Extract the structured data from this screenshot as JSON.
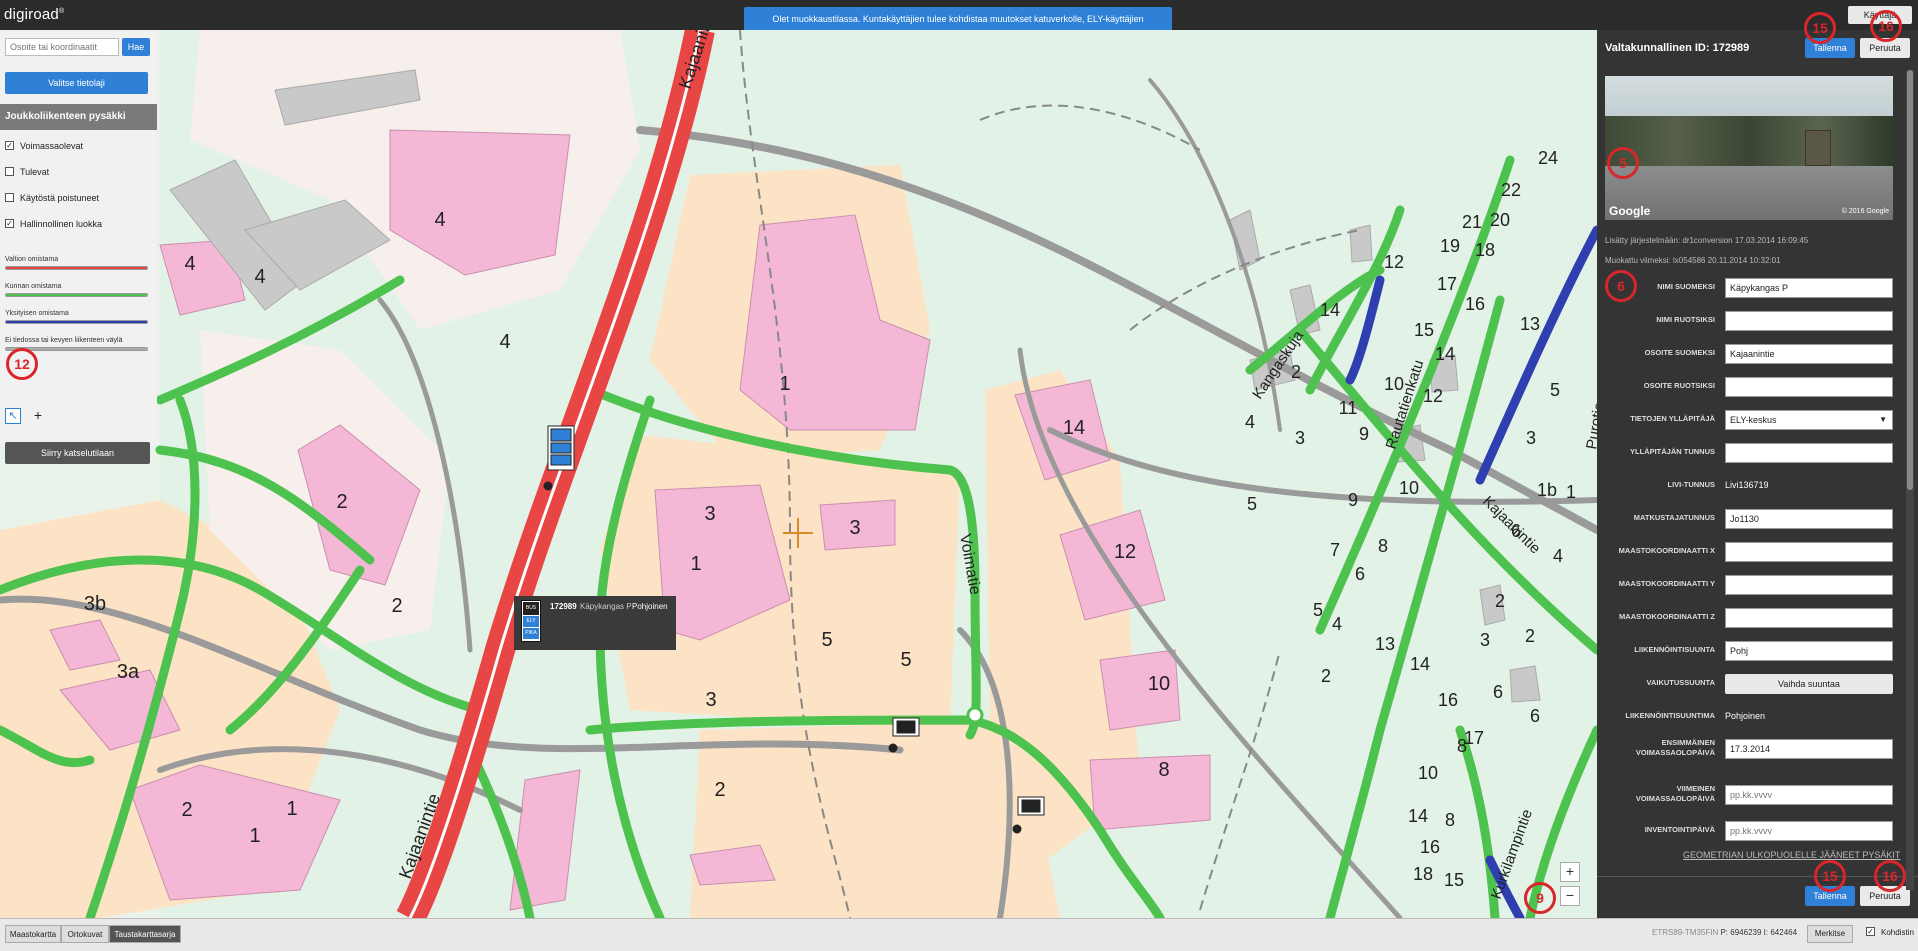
{
  "app": {
    "logo": "digiroad",
    "logo_mark": "®",
    "user_button": "Käyttäjä"
  },
  "notice": "Olet muokkaustilassa. Kuntakäyttäjien tulee kohdistaa muutokset katuverkolle, ELY-käyttäjien maantieverkolle.",
  "left_panel": {
    "search_placeholder": "Osoite tai koordinaatit",
    "search_button": "Hae",
    "select_layer_button": "Valitse tietolaji",
    "layer_title": "Joukkoliikenteen pysäkki",
    "checkboxes": [
      {
        "label": "Voimassaolevat",
        "checked": true
      },
      {
        "label": "Tulevat",
        "checked": false
      },
      {
        "label": "Käytöstä poistuneet",
        "checked": false
      },
      {
        "label": "Hallinnollinen luokka",
        "checked": true
      }
    ],
    "legend": [
      {
        "label": "Valtion omistama",
        "color": "#e84545"
      },
      {
        "label": "Kunnan omistama",
        "color": "#4ec24e"
      },
      {
        "label": "Yksityisen omistama",
        "color": "#2f3fb0"
      },
      {
        "label": "Ei tiedossa tai kevyen liikenteen väylä",
        "color": "#aaaaaa"
      }
    ],
    "view_mode_button": "Siirry katselutilaan"
  },
  "map": {
    "road_labels": [
      "Kajaanintie",
      "Kajaanintie",
      "Voimatie",
      "Kangaskuja",
      "Rautatienkatu",
      "Kajaanintie",
      "Kurkilampintie",
      "Purotie"
    ],
    "building_numbers": [
      "4",
      "4",
      "4",
      "4",
      "1",
      "2",
      "2",
      "3b",
      "3a",
      "2",
      "1",
      "1",
      "3",
      "3",
      "1",
      "5",
      "5",
      "3",
      "14",
      "12",
      "10",
      "8",
      "2",
      "24",
      "22",
      "21",
      "20",
      "19",
      "18",
      "17",
      "16",
      "15",
      "14",
      "14",
      "13",
      "12",
      "12",
      "11",
      "10",
      "10",
      "9",
      "9",
      "8",
      "7",
      "6",
      "6",
      "5",
      "5",
      "5",
      "4",
      "4",
      "4",
      "3",
      "3",
      "3",
      "2",
      "2",
      "2",
      "2",
      "1b",
      "1",
      "6",
      "6",
      "8",
      "8",
      "10",
      "14",
      "16",
      "18",
      "15",
      "17",
      "16",
      "14",
      "13"
    ],
    "zoom_in": "+",
    "zoom_out": "−",
    "popup": {
      "id": "172989",
      "name": "Käpykangas P",
      "direction": "Pohjoinen",
      "icon_labels": [
        "BUS",
        "ELY",
        "PIKA"
      ]
    }
  },
  "right_panel": {
    "asset_id_label": "Valtakunnallinen ID: 172989",
    "save_button": "Tallenna",
    "cancel_button": "Peruuta",
    "streetview_brand": "Google",
    "streetview_copyright": "© 2016 Google",
    "added": "Lisätty järjestelmään: dr1conversion 17.03.2014 16:09:45",
    "modified": "Muokattu viimeksi: lx054586 20.11.2014 10:32:01",
    "fields": [
      {
        "label": "NIMI SUOMEKSI",
        "type": "input",
        "value": "Käpykangas P"
      },
      {
        "label": "NIMI RUOTSIKSI",
        "type": "input",
        "value": ""
      },
      {
        "label": "OSOITE SUOMEKSI",
        "type": "input",
        "value": "Kajaanintie"
      },
      {
        "label": "OSOITE RUOTSIKSI",
        "type": "input",
        "value": ""
      },
      {
        "label": "TIETOJEN YLLÄPITÄJÄ",
        "type": "select",
        "value": "ELY-keskus"
      },
      {
        "label": "YLLÄPITÄJÄN TUNNUS",
        "type": "input",
        "value": ""
      },
      {
        "label": "LIVI-TUNNUS",
        "type": "text",
        "value": "Livi136719"
      },
      {
        "label": "MATKUSTAJATUNNUS",
        "type": "input",
        "value": "Jo1130"
      },
      {
        "label": "MAASTOKOORDINAATTI X",
        "type": "input",
        "value": ""
      },
      {
        "label": "MAASTOKOORDINAATTI Y",
        "type": "input",
        "value": ""
      },
      {
        "label": "MAASTOKOORDINAATTI Z",
        "type": "input",
        "value": ""
      },
      {
        "label": "LIIKENNÖINTISUUNTA",
        "type": "input",
        "value": "Pohj"
      },
      {
        "label": "VAIKUTUSSUUNTA",
        "type": "button",
        "value": "Vaihda suuntaa"
      },
      {
        "label": "LIIKENNÖINTISUUNTIMA",
        "type": "text",
        "value": "Pohjoinen"
      },
      {
        "label": "ENSIMMÄINEN VOIMASSAOLOPÄIVÄ",
        "type": "input",
        "value": "17.3.2014"
      },
      {
        "label": "VIIMEINEN VOIMASSAOLOPÄIVÄ",
        "type": "placeholder",
        "value": "pp.kk.vvvv"
      },
      {
        "label": "INVENTOINTIPÄIVÄ",
        "type": "placeholder",
        "value": "pp.kk.vvvv"
      }
    ],
    "outside_link": "GEOMETRIAN ULKOPUOLELLE JÄÄNEET PYSÄKIT"
  },
  "bottom_bar": {
    "tabs": [
      {
        "label": "Maastokartta",
        "active": false
      },
      {
        "label": "Ortokuvat",
        "active": false
      },
      {
        "label": "Taustakarttasarja",
        "active": true
      }
    ],
    "projection": "ETRS89-TM35FIN",
    "p_label": "P:",
    "p_value": "6946239",
    "i_label": "I:",
    "i_value": "642464",
    "mark_button": "Merkitse",
    "crosshair_label": "Kohdistin",
    "crosshair_checked": true
  },
  "annotation_markers": [
    "15",
    "16",
    "5",
    "6",
    "12",
    "9",
    "15",
    "16"
  ],
  "colors": {
    "accent": "#2f80d7",
    "state_road": "#e84545",
    "municipal_road": "#4ec24e",
    "private_road": "#2f3fb0",
    "marker": "#d8262b"
  }
}
